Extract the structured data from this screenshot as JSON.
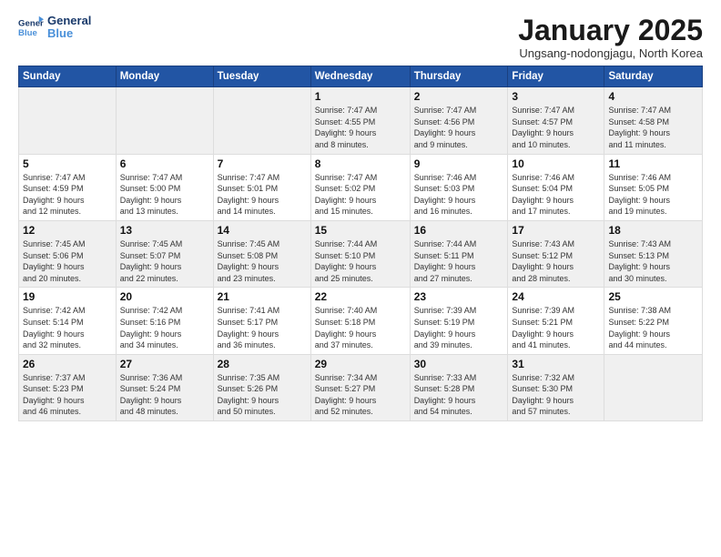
{
  "logo": {
    "line1": "General",
    "line2": "Blue"
  },
  "title": "January 2025",
  "subtitle": "Ungsang-nodongjagu, North Korea",
  "days": [
    "Sunday",
    "Monday",
    "Tuesday",
    "Wednesday",
    "Thursday",
    "Friday",
    "Saturday"
  ],
  "weeks": [
    [
      {
        "day": "",
        "info": ""
      },
      {
        "day": "",
        "info": ""
      },
      {
        "day": "",
        "info": ""
      },
      {
        "day": "1",
        "info": "Sunrise: 7:47 AM\nSunset: 4:55 PM\nDaylight: 9 hours\nand 8 minutes."
      },
      {
        "day": "2",
        "info": "Sunrise: 7:47 AM\nSunset: 4:56 PM\nDaylight: 9 hours\nand 9 minutes."
      },
      {
        "day": "3",
        "info": "Sunrise: 7:47 AM\nSunset: 4:57 PM\nDaylight: 9 hours\nand 10 minutes."
      },
      {
        "day": "4",
        "info": "Sunrise: 7:47 AM\nSunset: 4:58 PM\nDaylight: 9 hours\nand 11 minutes."
      }
    ],
    [
      {
        "day": "5",
        "info": "Sunrise: 7:47 AM\nSunset: 4:59 PM\nDaylight: 9 hours\nand 12 minutes."
      },
      {
        "day": "6",
        "info": "Sunrise: 7:47 AM\nSunset: 5:00 PM\nDaylight: 9 hours\nand 13 minutes."
      },
      {
        "day": "7",
        "info": "Sunrise: 7:47 AM\nSunset: 5:01 PM\nDaylight: 9 hours\nand 14 minutes."
      },
      {
        "day": "8",
        "info": "Sunrise: 7:47 AM\nSunset: 5:02 PM\nDaylight: 9 hours\nand 15 minutes."
      },
      {
        "day": "9",
        "info": "Sunrise: 7:46 AM\nSunset: 5:03 PM\nDaylight: 9 hours\nand 16 minutes."
      },
      {
        "day": "10",
        "info": "Sunrise: 7:46 AM\nSunset: 5:04 PM\nDaylight: 9 hours\nand 17 minutes."
      },
      {
        "day": "11",
        "info": "Sunrise: 7:46 AM\nSunset: 5:05 PM\nDaylight: 9 hours\nand 19 minutes."
      }
    ],
    [
      {
        "day": "12",
        "info": "Sunrise: 7:45 AM\nSunset: 5:06 PM\nDaylight: 9 hours\nand 20 minutes."
      },
      {
        "day": "13",
        "info": "Sunrise: 7:45 AM\nSunset: 5:07 PM\nDaylight: 9 hours\nand 22 minutes."
      },
      {
        "day": "14",
        "info": "Sunrise: 7:45 AM\nSunset: 5:08 PM\nDaylight: 9 hours\nand 23 minutes."
      },
      {
        "day": "15",
        "info": "Sunrise: 7:44 AM\nSunset: 5:10 PM\nDaylight: 9 hours\nand 25 minutes."
      },
      {
        "day": "16",
        "info": "Sunrise: 7:44 AM\nSunset: 5:11 PM\nDaylight: 9 hours\nand 27 minutes."
      },
      {
        "day": "17",
        "info": "Sunrise: 7:43 AM\nSunset: 5:12 PM\nDaylight: 9 hours\nand 28 minutes."
      },
      {
        "day": "18",
        "info": "Sunrise: 7:43 AM\nSunset: 5:13 PM\nDaylight: 9 hours\nand 30 minutes."
      }
    ],
    [
      {
        "day": "19",
        "info": "Sunrise: 7:42 AM\nSunset: 5:14 PM\nDaylight: 9 hours\nand 32 minutes."
      },
      {
        "day": "20",
        "info": "Sunrise: 7:42 AM\nSunset: 5:16 PM\nDaylight: 9 hours\nand 34 minutes."
      },
      {
        "day": "21",
        "info": "Sunrise: 7:41 AM\nSunset: 5:17 PM\nDaylight: 9 hours\nand 36 minutes."
      },
      {
        "day": "22",
        "info": "Sunrise: 7:40 AM\nSunset: 5:18 PM\nDaylight: 9 hours\nand 37 minutes."
      },
      {
        "day": "23",
        "info": "Sunrise: 7:39 AM\nSunset: 5:19 PM\nDaylight: 9 hours\nand 39 minutes."
      },
      {
        "day": "24",
        "info": "Sunrise: 7:39 AM\nSunset: 5:21 PM\nDaylight: 9 hours\nand 41 minutes."
      },
      {
        "day": "25",
        "info": "Sunrise: 7:38 AM\nSunset: 5:22 PM\nDaylight: 9 hours\nand 44 minutes."
      }
    ],
    [
      {
        "day": "26",
        "info": "Sunrise: 7:37 AM\nSunset: 5:23 PM\nDaylight: 9 hours\nand 46 minutes."
      },
      {
        "day": "27",
        "info": "Sunrise: 7:36 AM\nSunset: 5:24 PM\nDaylight: 9 hours\nand 48 minutes."
      },
      {
        "day": "28",
        "info": "Sunrise: 7:35 AM\nSunset: 5:26 PM\nDaylight: 9 hours\nand 50 minutes."
      },
      {
        "day": "29",
        "info": "Sunrise: 7:34 AM\nSunset: 5:27 PM\nDaylight: 9 hours\nand 52 minutes."
      },
      {
        "day": "30",
        "info": "Sunrise: 7:33 AM\nSunset: 5:28 PM\nDaylight: 9 hours\nand 54 minutes."
      },
      {
        "day": "31",
        "info": "Sunrise: 7:32 AM\nSunset: 5:30 PM\nDaylight: 9 hours\nand 57 minutes."
      },
      {
        "day": "",
        "info": ""
      }
    ]
  ],
  "shaded_rows": [
    0,
    2,
    4
  ]
}
